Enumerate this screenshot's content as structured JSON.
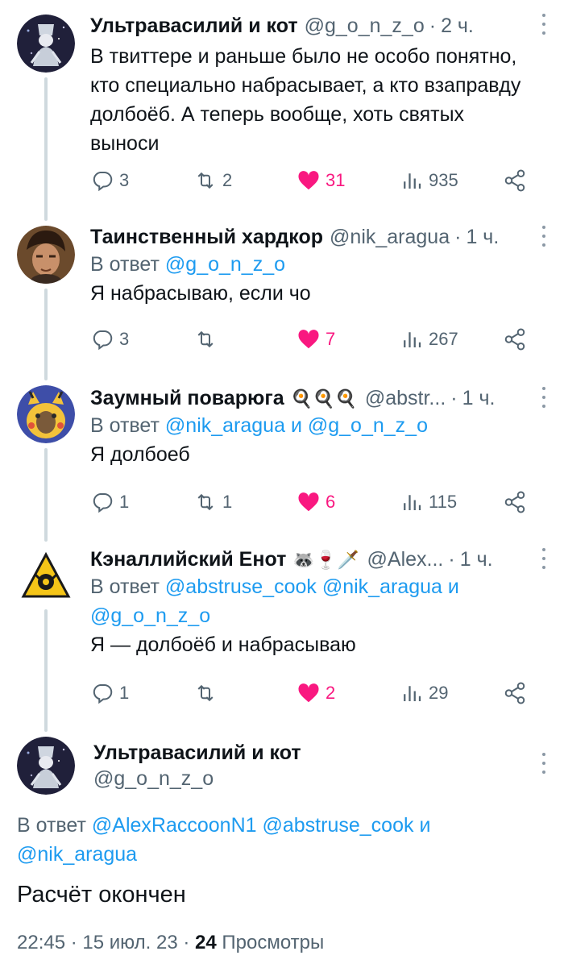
{
  "tweets": [
    {
      "name": "Ультравасилий и кот",
      "handle": "@g_o_n_z_o",
      "time": "2 ч.",
      "text": "В твиттере и раньше было не особо понятно, кто специально набрасывает, а кто взаправду долбоёб. А теперь вообще, хоть святых выноси",
      "replies": "3",
      "retweets": "2",
      "likes": "31",
      "views": "935"
    },
    {
      "name": "Таинственный хардкор",
      "handle": "@nik_aragua",
      "time": "1 ч.",
      "reply_prefix": "В ответ",
      "reply_mentions": "@g_o_n_z_o",
      "text": "Я набрасываю, если чо",
      "replies": "3",
      "retweets": "",
      "likes": "7",
      "views": "267"
    },
    {
      "name": "Заумный поварюга",
      "emojis": "🍳🍳🍳",
      "handle": "@abstr...",
      "time": "1 ч.",
      "reply_prefix": "В ответ",
      "reply_mention_1": "@nik_aragua",
      "reply_and": "и",
      "reply_mention_2": "@g_o_n_z_o",
      "text": "Я долбоеб",
      "replies": "1",
      "retweets": "1",
      "likes": "6",
      "views": "115"
    },
    {
      "name": "Кэналлийский Енот",
      "emojis": "🦝🍷🗡️",
      "handle": "@Alex...",
      "time": "1 ч.",
      "reply_prefix": "В ответ",
      "reply_mention_1": "@abstruse_cook",
      "reply_mention_2": "@nik_aragua",
      "reply_and": "и",
      "reply_mention_3": "@g_o_n_z_o",
      "text": "Я — долбоёб и набрасываю",
      "replies": "1",
      "retweets": "",
      "likes": "2",
      "views": "29"
    }
  ],
  "main": {
    "name": "Ультравасилий и кот",
    "handle": "@g_o_n_z_o",
    "reply_prefix": "В ответ",
    "reply_mention_1": "@AlexRaccoonN1",
    "reply_mention_2": "@abstruse_cook",
    "reply_and": "и",
    "reply_mention_3": "@nik_aragua",
    "text": "Расчёт окончен",
    "time": "22:45",
    "date": "15 июл. 23",
    "views_count": "24",
    "views_label": "Просмотры"
  },
  "colors": {
    "link": "#1d9bf0",
    "like": "#f91880",
    "muted": "#536471",
    "text": "#0f1419"
  },
  "icons": [
    "reply-icon",
    "retweet-icon",
    "heart-icon",
    "views-icon",
    "share-icon",
    "more-icon"
  ]
}
